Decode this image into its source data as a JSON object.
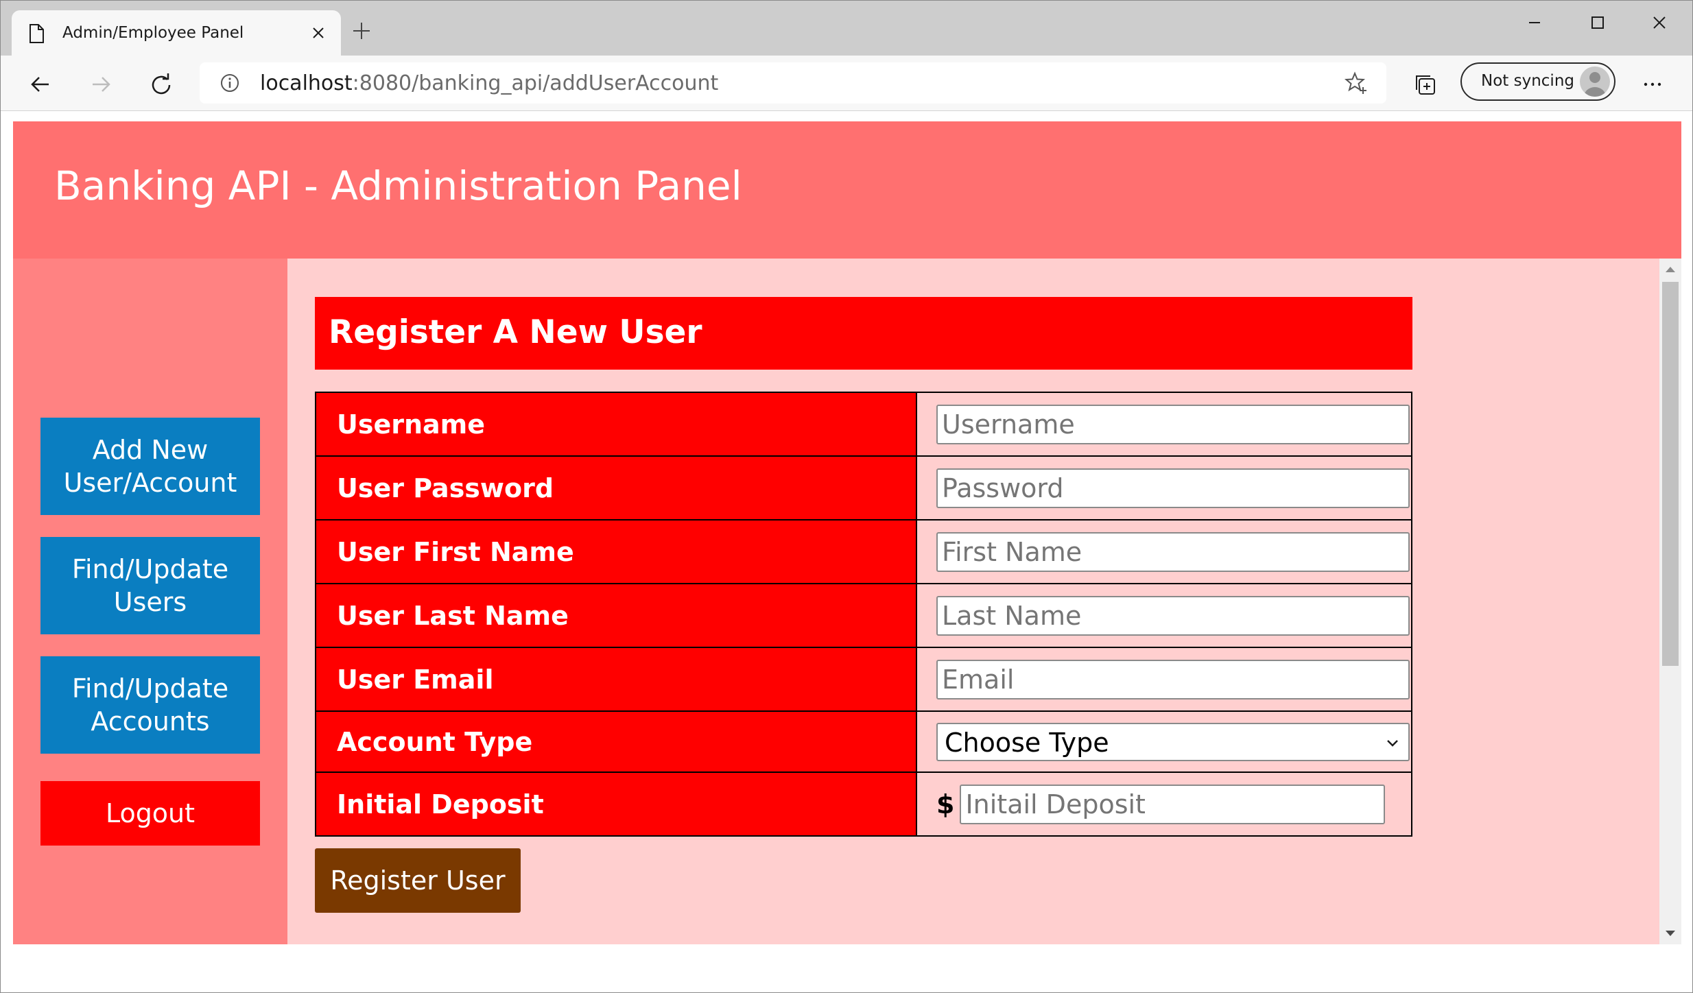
{
  "browser": {
    "tab_title": "Admin/Employee Panel",
    "url_host": "localhost",
    "url_rest": ":8080/banking_api/addUserAccount",
    "sync_label": "Not syncing"
  },
  "header": {
    "title": "Banking API - Administration Panel"
  },
  "sidebar": {
    "items": [
      {
        "label": "Add New User/Account"
      },
      {
        "label": "Find/Update Users"
      },
      {
        "label": "Find/Update Accounts"
      }
    ],
    "logout_label": "Logout"
  },
  "form": {
    "heading": "Register A New User",
    "fields": [
      {
        "label": "Username",
        "placeholder": "Username"
      },
      {
        "label": "User Password",
        "placeholder": "Password"
      },
      {
        "label": "User First Name",
        "placeholder": "First Name"
      },
      {
        "label": "User Last Name",
        "placeholder": "Last Name"
      },
      {
        "label": "User Email",
        "placeholder": "Email"
      }
    ],
    "account_type": {
      "label": "Account Type",
      "selected": "Choose Type"
    },
    "deposit": {
      "label": "Initial Deposit",
      "currency": "$",
      "placeholder": "Initail Deposit"
    },
    "submit_label": "Register User"
  },
  "colors": {
    "header_bg": "#ff7070",
    "sidebar_bg": "#ff8282",
    "main_bg": "#ffcfcf",
    "nav_button": "#0a7ec1",
    "accent_red": "#ff0000",
    "submit_button": "#7a3900"
  }
}
